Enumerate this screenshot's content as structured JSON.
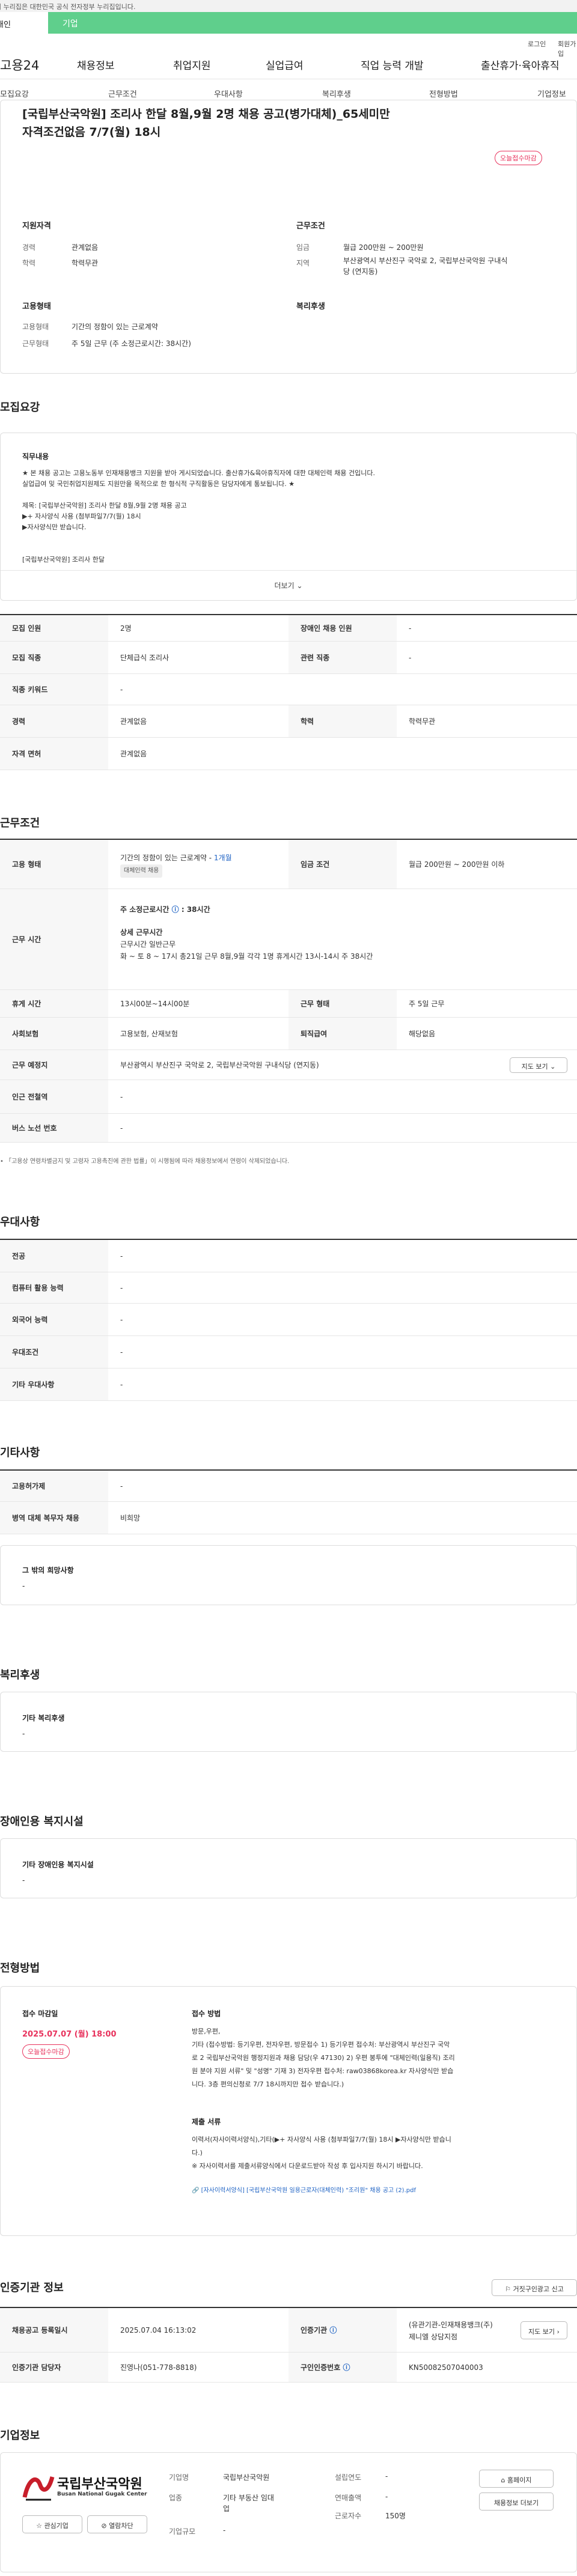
{
  "govbar": {
    "text": "이 누리집은 대한민국 공식 전자정부 누리집입니다."
  },
  "tabs": {
    "personal": "개인",
    "company": "기업"
  },
  "util": {
    "login": "로그인",
    "signup": "회원가입"
  },
  "gnb": {
    "logo": "고용24",
    "items": [
      "채용정보",
      "취업지원",
      "실업급여",
      "직업 능력 개발",
      "출산휴가·육아휴직"
    ]
  },
  "anchors": [
    "모집요강",
    "근무조건",
    "우대사항",
    "복리후생",
    "전형방법",
    "기업정보"
  ],
  "header": {
    "title_line1": "[국립부산국악원] 조리사 한달 8월,9월 2명 채용 공고(병가대체)_65세미만",
    "title_line2": "자격조건없음 7/7(월) 18시",
    "offer_badge": "오늘접수마감",
    "qual_title": "지원자격",
    "career_label": "경력",
    "career_value": "관계없음",
    "edu_label": "학력",
    "edu_value": "학력무관",
    "emp_title": "고용형태",
    "emptype_label": "고용형태",
    "emptype_value": "기간의 정함이 있는 근로계약",
    "worktype_label": "근무형태",
    "worktype_value": "주 5일 근무 (주 소정근로시간: 38시간)",
    "cond_title": "근무조건",
    "wage_label": "임금",
    "wage_value": "월급 200만원 ~ 200만원",
    "area_label": "지역",
    "area_value1": "부산광역시 부산진구 국악로 2, 국립부산국악원 구내식",
    "area_value2": "당 (연지동)",
    "welfare_title": "복리후생"
  },
  "recruit": {
    "title": "모집요강",
    "job_title": "직무내용",
    "line1": "★ 본 채용 공고는 고용노동부 인재채용뱅크 지원을 받아 게시되었습니다. 출산휴가&육아휴직자에 대한 대체인력 채용 건입니다.",
    "line2": "  실업급여 및 국민취업지원제도 지원만을 목적으로 한 형식적 구직활동은 담당자에게 통보됩니다. ★",
    "line3": "제목: [국립부산국악원] 조리사 한달 8월,9월 2명  채용 공고",
    "line4": "▶+ 자사양식 사용 (첨부파일7/7(월) 18시",
    "line5": "▶자사양식만 받습니다.",
    "line6": "[국립부산국악원] 조리사 한달",
    "more": "더보기"
  },
  "recruit_table": {
    "count_label": "모집 인원",
    "count_value": "2명",
    "disabled_label": "장애인 채용 인원",
    "disabled_value": "-",
    "job_label": "모집 직종",
    "job_value": "단체급식 조리사",
    "rel_label": "관련 직종",
    "rel_value": "-",
    "kw_label": "직종 키워드",
    "kw_value": "-",
    "career_label": "경력",
    "career_value": "관계없음",
    "edu_label": "학력",
    "edu_value": "학력무관",
    "license_label": "자격 면허",
    "license_value": "관계없음"
  },
  "work": {
    "title": "근무조건",
    "emptype_label": "고용 형태",
    "emptype_value": "기간의 정함이 있는 근로계약 -",
    "emptype_link": "1개월",
    "emptype_badge": "대체인력 채용",
    "wage_label": "임금 조건",
    "wage_value": "월급 200만원 ~ 200만원 이하",
    "time_label": "근무 시간",
    "time_head": "주 소정근로시간",
    "time_hours": ": 38시간",
    "time_detail_title": "상세 근무시간",
    "time_detail1": "근무시간 일반근무",
    "time_detail2": "화 ~ 토 8 ~ 17시 총21일 근무 8월,9월 각각 1명 휴게시간 13시-14시 주 38시간",
    "rest_label": "휴게 시간",
    "rest_value": "13시00분~14시00분",
    "form_label": "근무 형태",
    "form_value": "주 5일 근무",
    "ins_label": "사회보험",
    "ins_value": "고용보험, 산재보험",
    "ret_label": "퇴직급여",
    "ret_value": "해당없음",
    "place_label": "근무 예정지",
    "place_value": "부산광역시 부산진구 국악로 2, 국립부산국악원 구내식당 (연지동)",
    "map_button": "지도 보기",
    "subway_label": "인근 전철역",
    "subway_value": "-",
    "bus_label": "버스 노선 번호",
    "bus_value": "-",
    "note": "「고용상 연령차별금지 및 고령자 고용촉진에 관한 법률」이 시행됨에 따라 채용정보에서 연령이 삭제되었습니다."
  },
  "pref": {
    "title": "우대사항",
    "rows": [
      {
        "label": "전공",
        "value": "-"
      },
      {
        "label": "컴퓨터 활용 능력",
        "value": "-"
      },
      {
        "label": "외국어 능력",
        "value": "-"
      },
      {
        "label": "우대조건",
        "value": "-"
      },
      {
        "label": "기타 우대사항",
        "value": "-"
      }
    ]
  },
  "etc": {
    "title": "기타사항",
    "mil_label": "고용허가제",
    "mil_value": "-",
    "alt_label": "병역 대체 복무자 채용",
    "alt_value": "비희망",
    "other_title": "그 밖의 희망사항",
    "other_value": "-"
  },
  "welfare": {
    "title": "복리후생",
    "box_title": "기타 복리후생",
    "box_value": "-"
  },
  "disability": {
    "title": "장애인용 복지시설",
    "box_title": "기타 장애인용 복지시설",
    "box_value": "-"
  },
  "selection": {
    "title": "전형방법",
    "deadline_title": "접수 마감일",
    "deadline_value": "2025.07.07 (월) 18:00",
    "deadline_badge": "오늘접수마감",
    "method_title": "접수 방법",
    "method1": "방문,우편,",
    "method2": "기타 (접수방법: 등기우편, 전자우편, 방문접수 1) 등기우편 접수처: 부산광역시 부산진구 국악",
    "method3": "로 2 국립부산국악원  행정지원과 채용 담당(우 47130)  2) 우편 봉투에 \"대체인력(일용직) 조리",
    "method4": "원 분야 지원 서류\" 및 \"성명\" 기재 3) 전자우편 접수처: raw03868korea.kr 자사양식만 받습",
    "method5": "니다. 3층 편의신청로 7/7 18시까지만 접수 받습니다.)",
    "docs_title": "제출 서류",
    "docs1": "이력서(자사이력서양식),기타(▶+ 자사양식 사용 (첨부파일7/7(월) 18시 ▶자사양식만 받습니",
    "docs2": "다.)",
    "docs3": "※ 자사이력서를 제출서류양식에서 다운로드받아 작성 후 입사지원 하시기 바랍니다.",
    "file": "[자사이력서양식] [국립부산국악원 일용근로자(대체인력) \"조리원\" 채용 공고 (2).pdf"
  },
  "cert": {
    "title": "인증기관 정보",
    "report_button": "거짓구인광고 신고",
    "reg_label": "채용공고 등록일시",
    "reg_value": "2025.07.04 16:13:02",
    "org_label": "인증기관",
    "org_value1": "(유관기관-인재채용뱅크(주)",
    "org_value2": "제니엘 상담지점",
    "map_button": "지도 보기",
    "mgr_label": "인증기관 담당자",
    "mgr_value": "진영나(051-778-8818)",
    "no_label": "구인인증번호",
    "no_value": "KN50082507040003"
  },
  "company": {
    "title": "기업정보",
    "logo_kr": "국립부산국악원",
    "logo_en": "Busan National Gugak Center",
    "fav_button": "관심기업",
    "block_button": "열람차단",
    "name_label": "기업명",
    "name_value": "국립부산국악원",
    "biz_label": "업종",
    "biz_value1": "기타 부동산 임대",
    "biz_value2": "업",
    "size_label": "기업규모",
    "size_value": "-",
    "est_label": "설립연도",
    "est_value": "-",
    "sales_label": "연매출액",
    "sales_value": "-",
    "emp_label": "근로자수",
    "emp_value": "150명",
    "home_button": "홈페이지",
    "list_button": "채용정보 더보기"
  }
}
